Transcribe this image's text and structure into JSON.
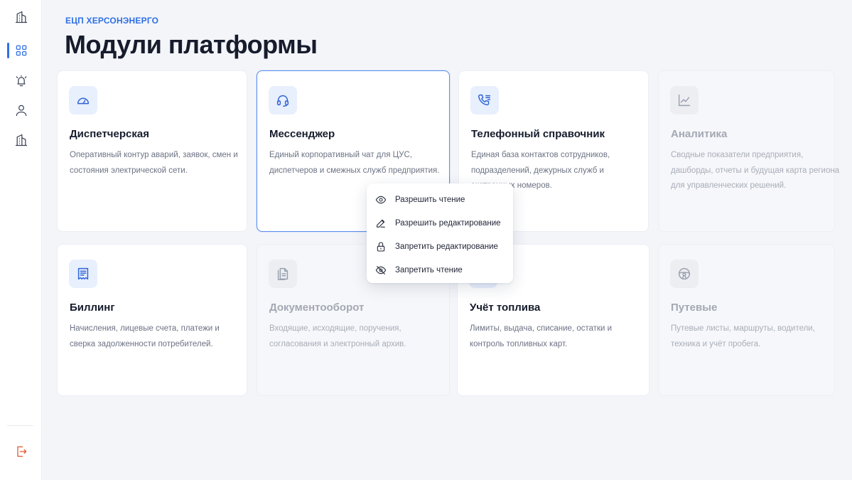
{
  "sidebar": {
    "items": [
      {
        "icon": "building-icon"
      },
      {
        "icon": "grid-icon",
        "active": true
      },
      {
        "icon": "alarm-icon"
      },
      {
        "icon": "user-icon"
      },
      {
        "icon": "building-icon"
      }
    ],
    "logout_icon": "logout-icon",
    "accent": "#2f6fe4",
    "logout_color": "#e2552f"
  },
  "header": {
    "org": "ЕЦП ХЕРСОНЭНЕРГО",
    "title": "Модули платформы"
  },
  "cards": [
    {
      "title": "Диспетчерская",
      "desc": "Оперативный контур аварий, заявок, смен и состояния электрической сети.",
      "icon": "speedometer-icon",
      "state": "active"
    },
    {
      "title": "Мессенджер",
      "desc": "Единый корпоративный чат для ЦУС, диспетчеров и смежных служб предприятия.",
      "icon": "headset-icon",
      "state": "selected"
    },
    {
      "title": "Телефонный справочник",
      "desc": "Единая база контактов сотрудников, подразделений, дежурных служб и экстренных номеров.",
      "icon": "phone-book-icon",
      "state": "active"
    },
    {
      "title": "Аналитика",
      "desc": "Сводные показатели предприятия, дашборды, отчеты и будущая карта региона для управленческих решений.",
      "icon": "chart-line-icon",
      "state": "disabled"
    },
    {
      "title": "Биллинг",
      "desc": "Начисления, лицевые счета, платежи и сверка задолженности потребителей.",
      "icon": "receipt-icon",
      "state": "active"
    },
    {
      "title": "Документооборот",
      "desc": "Входящие, исходящие, поручения, согласования и электронный архив.",
      "icon": "documents-icon",
      "state": "disabled"
    },
    {
      "title": "Учёт топлива",
      "desc": "Лимиты, выдача, списание, остатки и контроль топливных карт.",
      "icon": "fuel-icon",
      "state": "active"
    },
    {
      "title": "Путевые",
      "desc": "Путевые листы, маршруты, водители, техника и учёт пробега.",
      "icon": "steering-wheel-icon",
      "state": "disabled"
    }
  ],
  "context_menu": {
    "items": [
      {
        "label": "Разрешить чтение",
        "icon": "eye-icon"
      },
      {
        "label": "Разрешить редактирование",
        "icon": "pencil-icon"
      },
      {
        "label": "Запретить редактирование",
        "icon": "lock-icon"
      },
      {
        "label": "Запретить чтение",
        "icon": "eye-off-icon"
      }
    ]
  }
}
